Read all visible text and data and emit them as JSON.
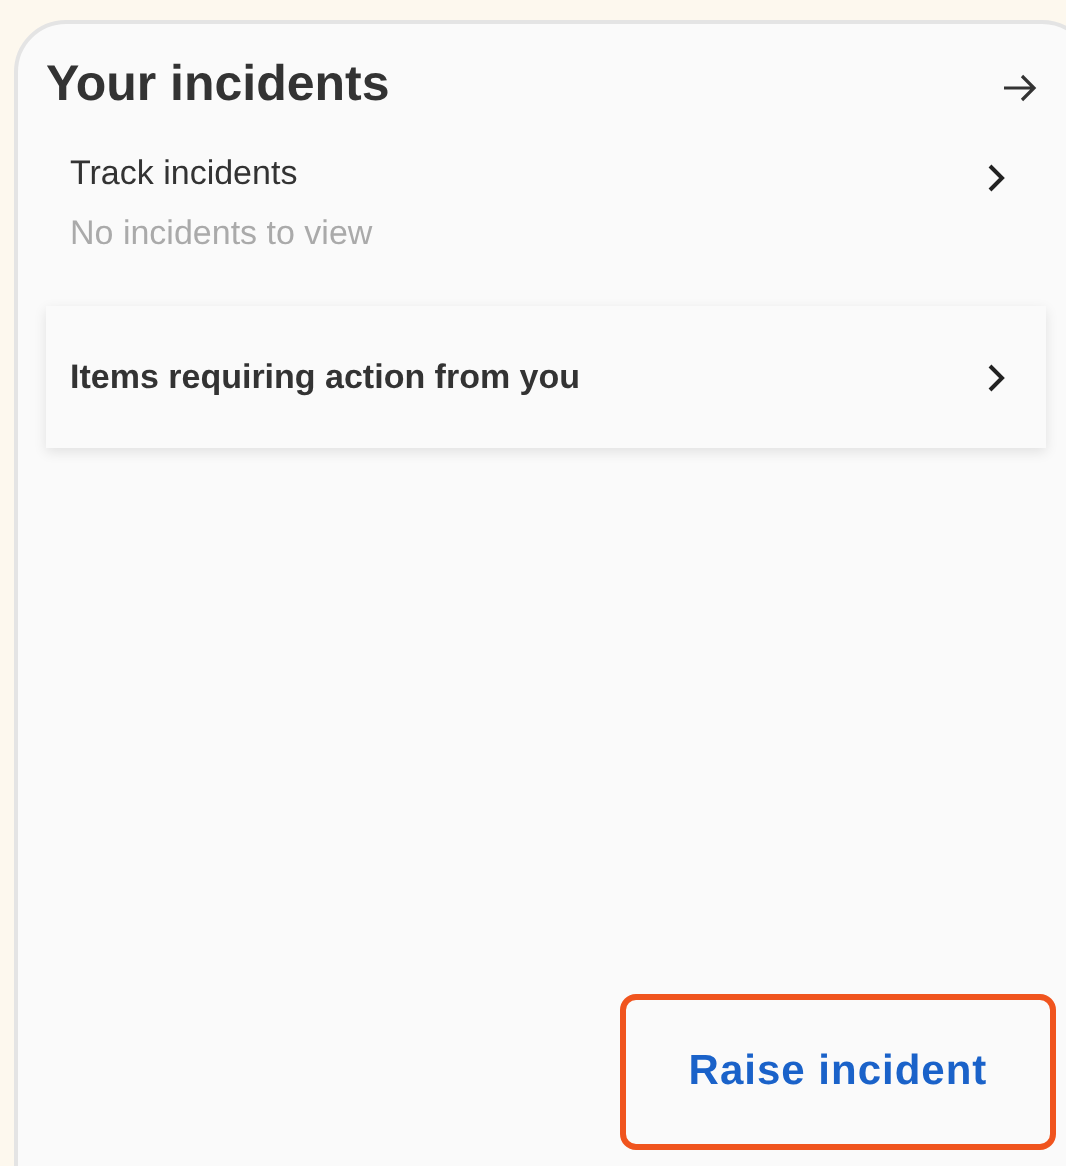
{
  "card": {
    "title": "Your incidents",
    "items": [
      {
        "kind": "link",
        "label": "Track incidents",
        "subtitle": "No incidents to view"
      },
      {
        "kind": "card",
        "label": "Items requiring action from you"
      }
    ],
    "button": {
      "label": "Raise incident",
      "highlighted": true
    }
  }
}
